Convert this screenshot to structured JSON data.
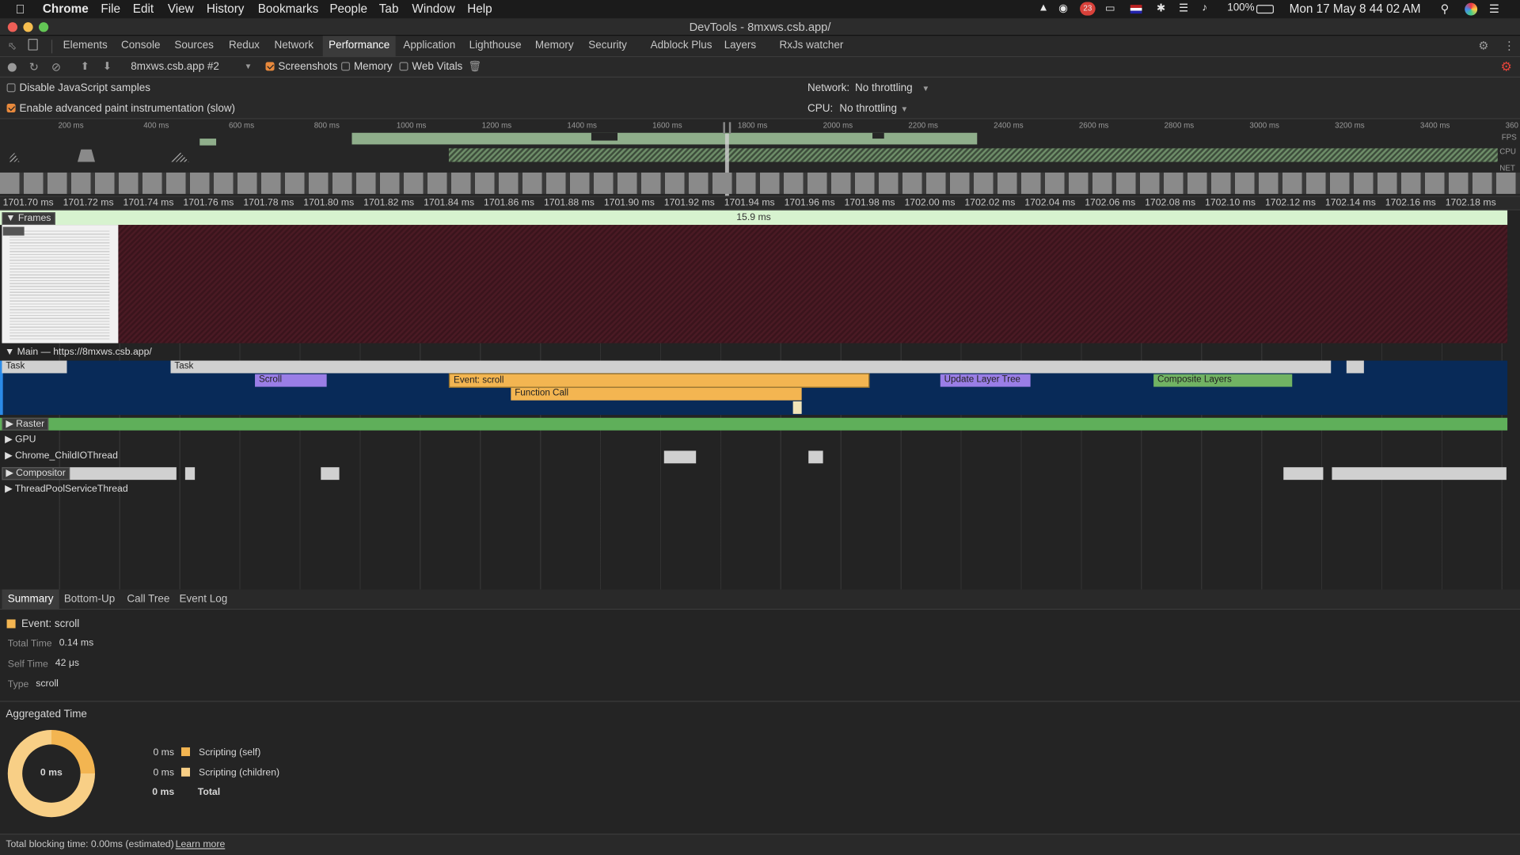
{
  "menubar": {
    "app_name": "Chrome",
    "items": [
      "File",
      "Edit",
      "View",
      "History",
      "Bookmarks",
      "People",
      "Tab",
      "Window",
      "Help"
    ],
    "battery": "100%",
    "clock": "Mon 17 May  8 44 02 AM",
    "badge_count": "23"
  },
  "window": {
    "title": "DevTools - 8mxws.csb.app/"
  },
  "tabs": [
    "Elements",
    "Console",
    "Sources",
    "Redux",
    "Network",
    "Performance",
    "Application",
    "Lighthouse",
    "Memory",
    "Security",
    "Adblock Plus",
    "Layers",
    "RxJs watcher"
  ],
  "active_tab": "Performance",
  "toolbar": {
    "recording_select": "8mxws.csb.app #2",
    "screenshots_label": "Screenshots",
    "memory_label": "Memory",
    "webvitals_label": "Web Vitals"
  },
  "settings": {
    "disable_js_samples": "Disable JavaScript samples",
    "advanced_paint": "Enable advanced paint instrumentation (slow)",
    "network_label": "Network:",
    "network_value": "No throttling",
    "cpu_label": "CPU:",
    "cpu_value": "No throttling"
  },
  "overview": {
    "ruler": [
      "200 ms",
      "400 ms",
      "600 ms",
      "800 ms",
      "1000 ms",
      "1200 ms",
      "1400 ms",
      "1600 ms",
      "1800 ms",
      "2000 ms",
      "2200 ms",
      "2400 ms",
      "2600 ms",
      "2800 ms",
      "3000 ms",
      "3200 ms",
      "3400 ms",
      "360"
    ],
    "fps_label": "FPS",
    "cpu_label": "CPU",
    "net_label": "NET"
  },
  "timeline": {
    "ticks": [
      "1701.70 ms",
      "1701.72 ms",
      "1701.74 ms",
      "1701.76 ms",
      "1701.78 ms",
      "1701.80 ms",
      "1701.82 ms",
      "1701.84 ms",
      "1701.86 ms",
      "1701.88 ms",
      "1701.90 ms",
      "1701.92 ms",
      "1701.94 ms",
      "1701.96 ms",
      "1701.98 ms",
      "1702.00 ms",
      "1702.02 ms",
      "1702.04 ms",
      "1702.06 ms",
      "1702.08 ms",
      "1702.10 ms",
      "1702.12 ms",
      "1702.14 ms",
      "1702.16 ms",
      "1702.18 ms"
    ],
    "frames_label": "Frames",
    "frame_duration": "15.9 ms",
    "main_label": "Main — https://8mxws.csb.app/",
    "events": {
      "task1": "Task",
      "task2": "Task",
      "scroll": "Scroll",
      "event_scroll": "Event: scroll",
      "function_call": "Function Call",
      "update_layer_tree": "Update Layer Tree",
      "composite_layers": "Composite Layers"
    },
    "threads": {
      "raster": "Raster",
      "gpu": "GPU",
      "childio": "Chrome_ChildIOThread",
      "compositor": "Compositor",
      "threadpool": "ThreadPoolServiceThread"
    }
  },
  "bottom_tabs": [
    "Summary",
    "Bottom-Up",
    "Call Tree",
    "Event Log"
  ],
  "summary": {
    "event_title": "Event: scroll",
    "total_time_label": "Total Time",
    "total_time": "0.14 ms",
    "self_time_label": "Self Time",
    "self_time": "42 μs",
    "type_label": "Type",
    "type_value": "scroll",
    "aggregated_title": "Aggregated Time",
    "donut_center": "0 ms",
    "legend": [
      {
        "value": "0 ms",
        "label": "Scripting (self)"
      },
      {
        "value": "0 ms",
        "label": "Scripting (children)"
      },
      {
        "value": "0 ms",
        "label": "Total"
      }
    ]
  },
  "status": {
    "text": "Total blocking time: 0.00ms (estimated)",
    "link": "Learn more"
  },
  "colors": {
    "scripting": "#f3b551",
    "rendering": "#9a7ee6",
    "painting": "#71b363",
    "main_bg": "#082a58",
    "frames_header": "#d7f3cf",
    "accent": "#e8893c"
  }
}
